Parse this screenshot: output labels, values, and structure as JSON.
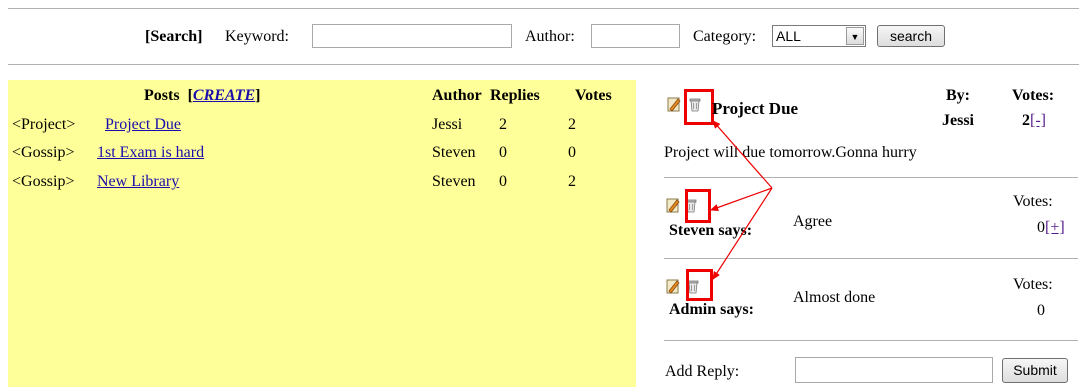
{
  "search": {
    "label": "[Search]",
    "keyword_label": "Keyword:",
    "keyword_value": "",
    "author_label": "Author:",
    "author_value": "",
    "category_label": "Category:",
    "category_value": "ALL",
    "button": "search"
  },
  "posts_table": {
    "title": "Posts",
    "create_link": "CREATE",
    "open_bracket": "[",
    "close_bracket": "]",
    "headers": {
      "author": "Author",
      "replies": "Replies",
      "votes": "Votes"
    },
    "rows": [
      {
        "category": "<Project>",
        "title": "Project Due",
        "author": "Jessi",
        "replies": "2",
        "votes": "2"
      },
      {
        "category": "<Gossip>",
        "title": "1st Exam is hard",
        "author": "Steven",
        "replies": "0",
        "votes": "0"
      },
      {
        "category": "<Gossip>",
        "title": "New Library",
        "author": "Steven",
        "replies": "0",
        "votes": "2"
      }
    ]
  },
  "post_detail": {
    "title": "Project Due",
    "by_label": "By:",
    "author": "Jessi",
    "votes_label": "Votes:",
    "votes": "2",
    "vote_action": "[-]",
    "body": "Project will due tomorrow.Gonna hurry"
  },
  "replies": [
    {
      "author_says": "Steven says:",
      "text": "Agree",
      "votes_label": "Votes:",
      "votes": "0",
      "vote_action": "[+]"
    },
    {
      "author_says": "Admin says:",
      "text": "Almost done",
      "votes_label": "Votes:",
      "votes": "0"
    }
  ],
  "reply_form": {
    "label": "Add Reply:",
    "value": "",
    "button": "Submit"
  },
  "colors": {
    "panel_bg": "#ffff99",
    "link": "#1a0dab",
    "vote_link": "#551a8b",
    "highlight": "#ee0000"
  },
  "icons": [
    "edit-icon",
    "trash-icon"
  ]
}
